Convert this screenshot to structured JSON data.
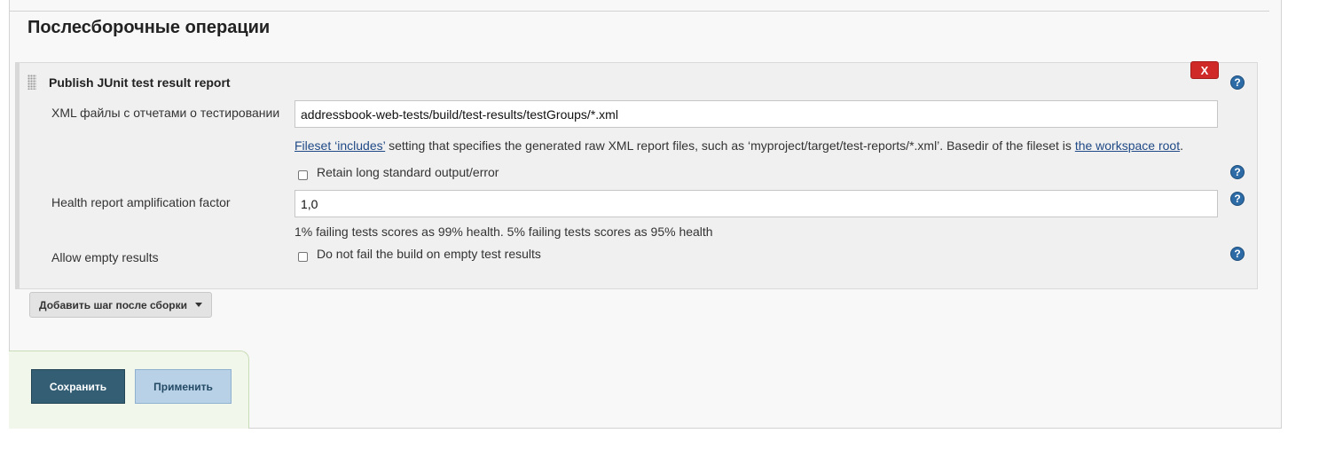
{
  "section": {
    "title": "Послесборочные операции"
  },
  "step": {
    "title": "Publish JUnit test result report",
    "delete_label": "X",
    "help_glyph": "?",
    "xml_files": {
      "label": "XML файлы с отчетами о тестировании",
      "value": "addressbook-web-tests/build/test-results/testGroups/*.xml",
      "desc_link1": "Fileset ‘includes’",
      "desc_text1": " setting that specifies the generated raw XML report files, such as ‘myproject/target/test-reports/*.xml’. Basedir of the fileset is ",
      "desc_link2": "the workspace root",
      "desc_text2": "."
    },
    "retain_output": {
      "label": "Retain long standard output/error",
      "checked": false
    },
    "health_factor": {
      "label": "Health report amplification factor",
      "value": "1,0",
      "desc": "1% failing tests scores as 99% health. 5% failing tests scores as 95% health"
    },
    "allow_empty": {
      "label": "Allow empty results",
      "checkbox_label": "Do not fail the build on empty test results",
      "checked": false
    }
  },
  "add_step_button": "Добавить шаг после сборки",
  "buttons": {
    "save": "Сохранить",
    "apply": "Применить"
  },
  "colors": {
    "delete": "#cf2a27",
    "help": "#2d6ba6",
    "save": "#335e74",
    "apply": "#b8d1e6",
    "link": "#204a87"
  }
}
